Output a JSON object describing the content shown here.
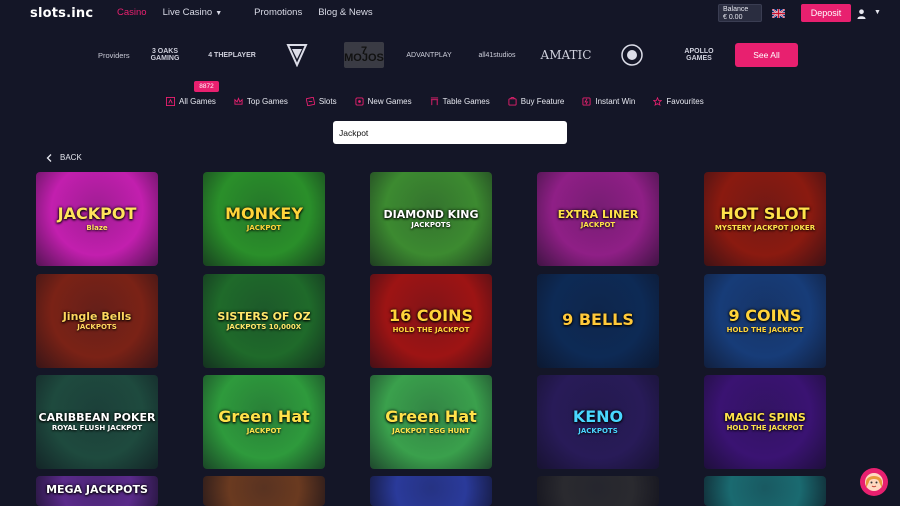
{
  "header": {
    "logo": "slots.inc",
    "nav": [
      {
        "label": "Casino",
        "active": true
      },
      {
        "label": "Live Casino",
        "dropdown": true
      },
      {
        "label": "Promotions"
      },
      {
        "label": "Blog & News"
      }
    ],
    "balance_label": "Balance",
    "balance_value": "€ 0.00",
    "deposit_label": "Deposit"
  },
  "providers": {
    "label": "Providers",
    "items": [
      "3 OAKS GAMING",
      "4 THEPLAYER",
      "7777 GAMING",
      "7 MOJOS",
      "ADVANTPLAY",
      "all41studios",
      "AMATIC",
      "",
      "APOLLO GAMES"
    ],
    "see_all_label": "See All"
  },
  "categories": {
    "all_games_count": "8872",
    "items": [
      {
        "label": "All Games",
        "icon": "all-games-icon"
      },
      {
        "label": "Top Games",
        "icon": "crown-icon"
      },
      {
        "label": "Slots",
        "icon": "slot-icon"
      },
      {
        "label": "New Games",
        "icon": "sparkle-icon"
      },
      {
        "label": "Table Games",
        "icon": "table-icon"
      },
      {
        "label": "Buy Feature",
        "icon": "cart-icon"
      },
      {
        "label": "Instant Win",
        "icon": "lightning-icon"
      },
      {
        "label": "Favourites",
        "icon": "star-icon"
      }
    ]
  },
  "search": {
    "value": "Jackpot",
    "placeholder": "Search"
  },
  "back_label": "BACK",
  "games": [
    {
      "title": "JACKPOT",
      "sub": "Blaze",
      "bg": "#c21fae",
      "fg": "#ffe45c"
    },
    {
      "title": "MONKEY",
      "sub": "JACKPOT",
      "bg": "#2a8f2a",
      "fg": "#ffd43a"
    },
    {
      "title": "DIAMOND KING",
      "sub": "JACKPOTS",
      "bg": "#3c8a30",
      "fg": "#ffffff"
    },
    {
      "title": "EXTRA LINER",
      "sub": "JACKPOT",
      "bg": "#8f1f86",
      "fg": "#ffe24a"
    },
    {
      "title": "HOT SLOT",
      "sub": "MYSTERY JACKPOT JOKER",
      "bg": "#8a1a10",
      "fg": "#ffe24a"
    },
    {
      "title": "Jingle Bells",
      "sub": "JACKPOTS",
      "bg": "#7a2216",
      "fg": "#ffd75e"
    },
    {
      "title": "SISTERS OF OZ",
      "sub": "JACKPOTS 10,000X",
      "bg": "#1f6a2a",
      "fg": "#ffe76a"
    },
    {
      "title": "16 COINS",
      "sub": "HOLD THE JACKPOT",
      "bg": "#9d1414",
      "fg": "#ffd43a"
    },
    {
      "title": "9 BELLS",
      "sub": "",
      "bg": "#0d2a55",
      "fg": "#ffc93a"
    },
    {
      "title": "9 COINS",
      "sub": "HOLD THE JACKPOT",
      "bg": "#173c78",
      "fg": "#ffd43a"
    },
    {
      "title": "CARIBBEAN POKER",
      "sub": "ROYAL FLUSH JACKPOT",
      "bg": "#1e4a3e",
      "fg": "#ffffff"
    },
    {
      "title": "Green Hat",
      "sub": "JACKPOT",
      "bg": "#2e9a3c",
      "fg": "#ffe24a"
    },
    {
      "title": "Green Hat",
      "sub": "JACKPOT EGG HUNT",
      "bg": "#3aa04c",
      "fg": "#ffe24a"
    },
    {
      "title": "KENO",
      "sub": "JACKPOTS",
      "bg": "#281b58",
      "fg": "#4ad7ff"
    },
    {
      "title": "MAGIC SPINS",
      "sub": "HOLD THE JACKPOT",
      "bg": "#3a1372",
      "fg": "#ffe24a"
    },
    {
      "title": "MEGA JACKPOTS",
      "sub": "",
      "bg": "#5a2a8a",
      "fg": "#ffffff"
    },
    {
      "title": "",
      "sub": "",
      "bg": "#6a3a20",
      "fg": "#ffffff"
    },
    {
      "title": "",
      "sub": "",
      "bg": "#2a3a9a",
      "fg": "#ffffff"
    },
    {
      "title": "",
      "sub": "",
      "bg": "#2a2a2f",
      "fg": "#ffffff"
    },
    {
      "title": "",
      "sub": "",
      "bg": "#1a6a70",
      "fg": "#ffffff"
    }
  ],
  "colors": {
    "accent": "#e8206f",
    "background": "#141627"
  }
}
